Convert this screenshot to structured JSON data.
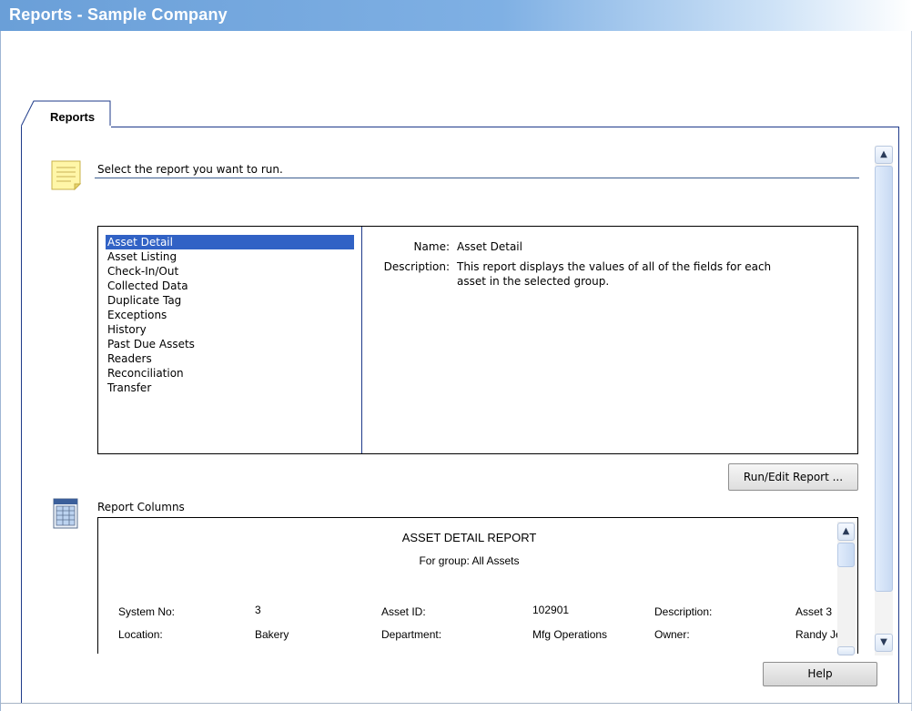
{
  "window": {
    "title": "Reports - Sample Company"
  },
  "tabs": [
    {
      "label": "Reports"
    }
  ],
  "select_section": {
    "heading": "Select the report you want to run."
  },
  "reports": {
    "items": [
      "Asset Detail",
      "Asset Listing",
      "Check-In/Out",
      "Collected Data",
      "Duplicate Tag",
      "Exceptions",
      "History",
      "Past Due Assets",
      "Readers",
      "Reconciliation",
      "Transfer"
    ],
    "selected_index": 0
  },
  "detail": {
    "name_label": "Name:",
    "name_value": "Asset Detail",
    "description_label": "Description:",
    "description_line1": "This report displays the values of all of the fields for each",
    "description_line2": "asset in the selected group."
  },
  "buttons": {
    "run_edit": "Run/Edit Report ...",
    "help": "Help"
  },
  "columns_section": {
    "heading": "Report Columns"
  },
  "preview": {
    "title": "ASSET DETAIL REPORT",
    "subtitle": "For group: All Assets",
    "rows": [
      [
        "System No:",
        "3",
        "Asset ID:",
        "102901",
        "Description:",
        "Asset 3"
      ],
      [
        "Location:",
        "Bakery",
        "Department:",
        "Mfg Operations",
        "Owner:",
        "Randy Je"
      ]
    ]
  },
  "icons": {
    "section1": "note-icon",
    "section2": "grid-icon",
    "scroll_up": "chevron-up-icon",
    "scroll_down": "chevron-down-icon"
  },
  "colors": {
    "title_bar": "#6a9fd8",
    "selection": "#3162c5",
    "panel_border": "#1e3a8a"
  }
}
